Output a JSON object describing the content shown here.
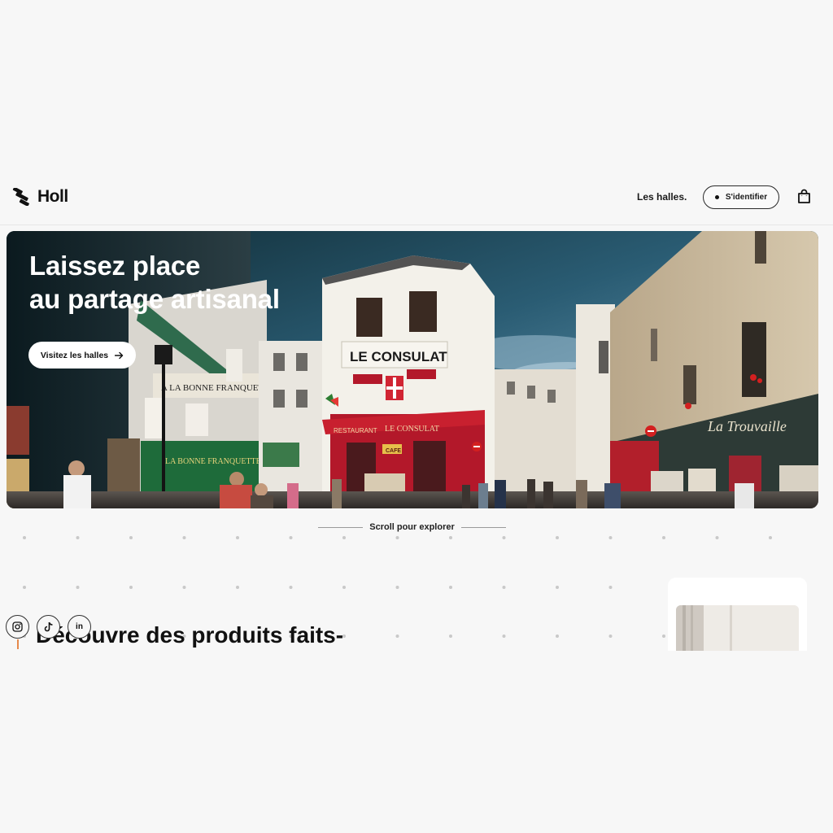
{
  "header": {
    "logo_text": "Holl",
    "nav_link": "Les halles.",
    "login_label": "S'identifier",
    "cart_icon": "shopping-bag-icon"
  },
  "hero": {
    "title_line1": "Laissez place",
    "title_line2": "au partage artisanal",
    "cta_label": "Visitez les halles",
    "cta_icon": "arrow-right-icon",
    "photo_signs": {
      "consulat_top": "LE CONSULAT",
      "consulat_awning": "LE CONSULAT",
      "restaurant": "RESTAURANT",
      "cafe": "CAFE",
      "franquette": "A LA BONNE FRANQUETTE",
      "franquette_green": "LA BONNE FRANQUETTE",
      "trouvaille": "La Trouvaille"
    }
  },
  "scroll_hint": "Scroll pour explorer",
  "section": {
    "title": "Découvre des produits faits-"
  },
  "socials": [
    {
      "name": "instagram-icon"
    },
    {
      "name": "tiktok-icon"
    },
    {
      "name": "linkedin-icon",
      "label": "in"
    }
  ],
  "colors": {
    "accent": "#e6894b",
    "sky_top": "#1b3a46",
    "sky_bottom": "#4f87a8",
    "restaurant_red": "#b3182a",
    "franquette_green": "#1e6b3a"
  }
}
